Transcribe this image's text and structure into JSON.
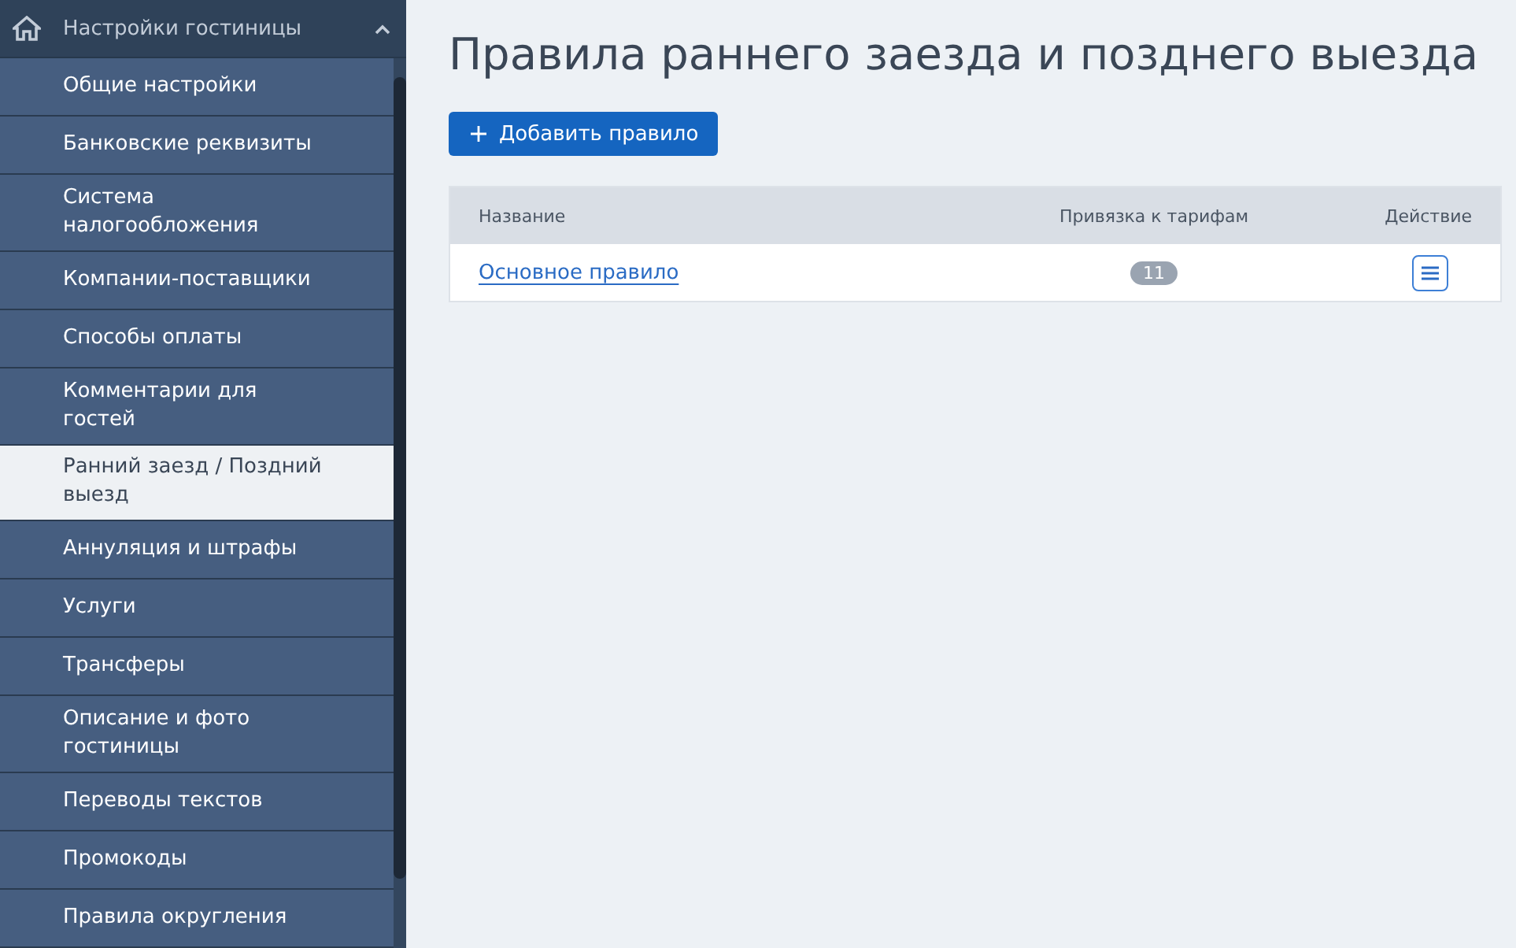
{
  "sidebar": {
    "section": {
      "title": "Настройки гостиницы",
      "expanded": true
    },
    "items": [
      {
        "label": "Общие настройки",
        "selected": false
      },
      {
        "label": "Банковские реквизиты",
        "selected": false
      },
      {
        "label": "Система налогообложения",
        "selected": false
      },
      {
        "label": "Компании-поставщики",
        "selected": false
      },
      {
        "label": "Способы оплаты",
        "selected": false
      },
      {
        "label": "Комментарии для гостей",
        "selected": false
      },
      {
        "label": "Ранний заезд / Поздний выезд",
        "selected": true
      },
      {
        "label": "Аннуляция и штрафы",
        "selected": false
      },
      {
        "label": "Услуги",
        "selected": false
      },
      {
        "label": "Трансферы",
        "selected": false
      },
      {
        "label": "Описание и фото гостиницы",
        "selected": false
      },
      {
        "label": "Переводы текстов",
        "selected": false
      },
      {
        "label": "Промокоды",
        "selected": false
      },
      {
        "label": "Правила округления",
        "selected": false
      }
    ]
  },
  "page": {
    "title": "Правила раннего заезда и позднего выезда",
    "add_button": "Добавить правило"
  },
  "table": {
    "columns": [
      "Название",
      "Привязка к тарифам",
      "Действие"
    ],
    "rows": [
      {
        "name": "Основное правило",
        "tariffs": "11"
      }
    ]
  }
}
